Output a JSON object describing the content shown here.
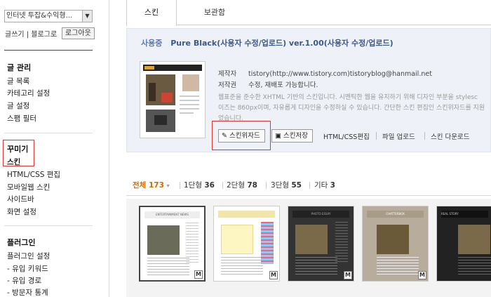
{
  "sidebar": {
    "blog_select": "인터넷 투잡&수익형...",
    "links": [
      "글쓰기",
      "블로그로"
    ],
    "logout": "로그아웃",
    "sections": [
      {
        "title": "글 관리",
        "items": [
          "글 목록",
          "카테고리 설정",
          "글 설정",
          "스팸 필터"
        ]
      },
      {
        "title": "꾸미기",
        "items": [
          "스킨",
          "HTML/CSS 편집",
          "모바일웹 스킨",
          "사이드바",
          "화면 설정"
        ]
      },
      {
        "title": "플러그인",
        "items": [
          "플러그인 설정",
          "- 유입 키워드",
          "- 유입 경로",
          "- 방문자 통계"
        ]
      }
    ]
  },
  "tabs": [
    "스킨",
    "보관함"
  ],
  "current": {
    "status": "사용중",
    "name": "Pure Black(사용자 수정/업로드) ver.1.00(사용자 수정/업로드)",
    "maker_key": "제작자",
    "maker_val": "tistory(http://www.tistory.com)tistoryblog@hanmail.net",
    "copyright_key": "저작권",
    "copyright_val": "수정, 재배포 가능합니다.",
    "description": "웹표준을 준수한 XHTML 기반의 스킨입니다. 시멘틱한 웹을 유지하기 위해 디자인 부분을 stylesc\n이즈는 860px이며, 자유롭게 디자인을 수정하실 수 있습니다. 간단한 스킨 편집인 스킨위자드를 지원\n었습니다.",
    "buttons": {
      "wizard": "스킨위자드",
      "save": "스킨저장"
    },
    "links": [
      "HTML/CSS편집",
      "파일 업로드",
      "스킨 다운로드"
    ]
  },
  "filters": {
    "all_label": "전체",
    "all_count": "173",
    "items": [
      {
        "label": "1단형",
        "count": "36"
      },
      {
        "label": "2단형",
        "count": "78"
      },
      {
        "label": "3단형",
        "count": "55"
      },
      {
        "label": "기타",
        "count": "3"
      }
    ]
  },
  "gallery": {
    "badge": "M",
    "thumb_titles": [
      "ENTERTAINMENT NEWS",
      "",
      "PHOTO ESSAY",
      "CHATTERBOX",
      "REAL STORY"
    ]
  },
  "colors": {
    "accent": "#d06a00",
    "highlight_box": "#dd3333",
    "panel_bg": "#eef1f7"
  }
}
